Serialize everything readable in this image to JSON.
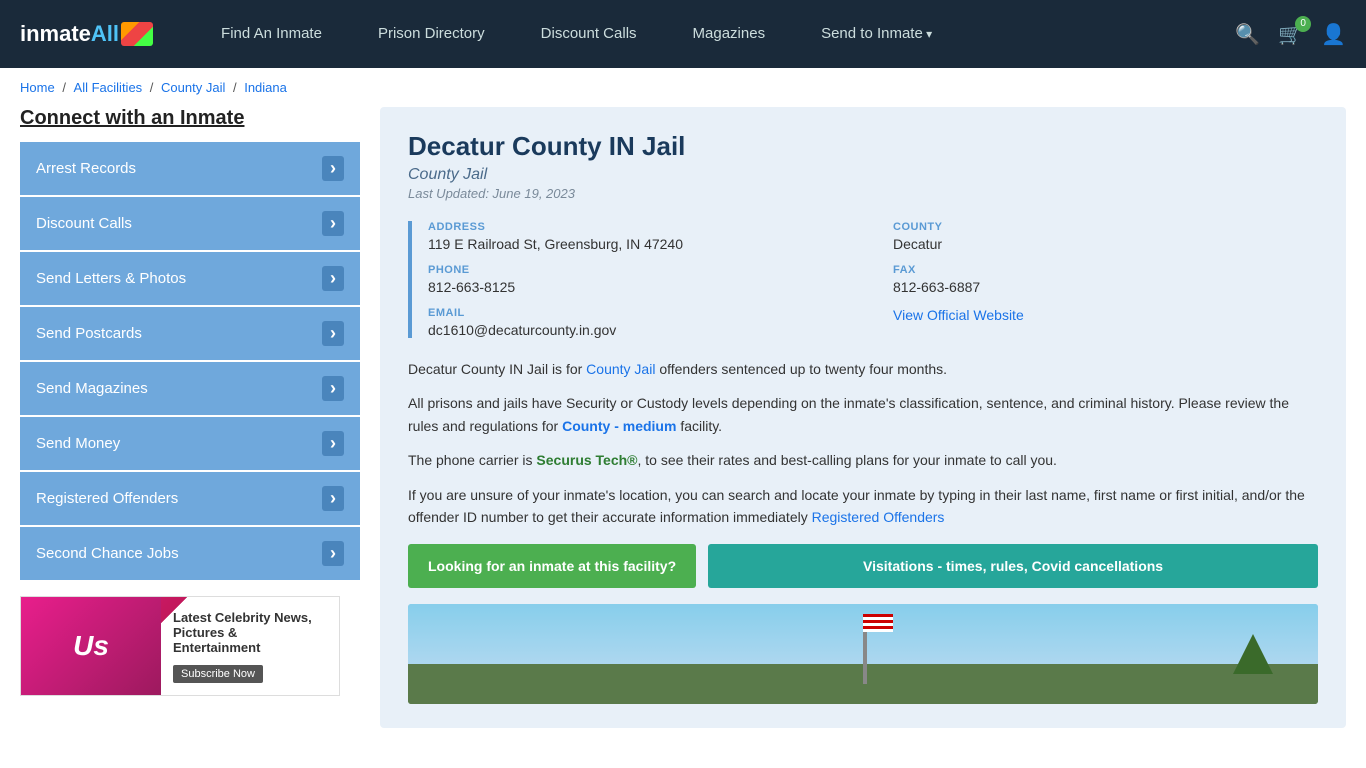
{
  "navbar": {
    "logo_text": "inmate",
    "logo_all": "All",
    "nav_links": [
      {
        "label": "Find An Inmate",
        "has_arrow": false
      },
      {
        "label": "Prison Directory",
        "has_arrow": false
      },
      {
        "label": "Discount Calls",
        "has_arrow": false
      },
      {
        "label": "Magazines",
        "has_arrow": false
      },
      {
        "label": "Send to Inmate",
        "has_arrow": true
      }
    ],
    "cart_count": "0"
  },
  "breadcrumb": {
    "home": "Home",
    "all_facilities": "All Facilities",
    "county_jail": "County Jail",
    "indiana": "Indiana"
  },
  "sidebar": {
    "title": "Connect with an Inmate",
    "items": [
      {
        "label": "Arrest Records"
      },
      {
        "label": "Discount Calls"
      },
      {
        "label": "Send Letters & Photos"
      },
      {
        "label": "Send Postcards"
      },
      {
        "label": "Send Magazines"
      },
      {
        "label": "Send Money"
      },
      {
        "label": "Registered Offenders"
      },
      {
        "label": "Second Chance Jobs"
      }
    ],
    "ad": {
      "brand": "Us",
      "title": "Latest Celebrity News, Pictures & Entertainment",
      "btn": "Subscribe Now"
    }
  },
  "facility": {
    "title": "Decatur County IN Jail",
    "type": "County Jail",
    "updated": "Last Updated: June 19, 2023",
    "address_label": "ADDRESS",
    "address_value": "119 E Railroad St, Greensburg, IN 47240",
    "county_label": "COUNTY",
    "county_value": "Decatur",
    "phone_label": "PHONE",
    "phone_value": "812-663-8125",
    "fax_label": "FAX",
    "fax_value": "812-663-6887",
    "email_label": "EMAIL",
    "email_value": "dc1610@decaturcounty.in.gov",
    "website_label": "View Official Website",
    "description1": "Decatur County IN Jail is for ",
    "description1_link": "County Jail",
    "description1_end": " offenders sentenced up to twenty four months.",
    "description2": "All prisons and jails have Security or Custody levels depending on the inmate's classification, sentence, and criminal history. Please review the rules and regulations for ",
    "description2_link": "County - medium",
    "description2_end": " facility.",
    "description3": "The phone carrier is ",
    "description3_link": "Securus Tech®",
    "description3_end": ", to see their rates and best-calling plans for your inmate to call you.",
    "description4": "If you are unsure of your inmate's location, you can search and locate your inmate by typing in their last name, first name or first initial, and/or the offender ID number to get their accurate information immediately ",
    "description4_link": "Registered Offenders",
    "btn1": "Looking for an inmate at this facility?",
    "btn2": "Visitations - times, rules, Covid cancellations"
  }
}
